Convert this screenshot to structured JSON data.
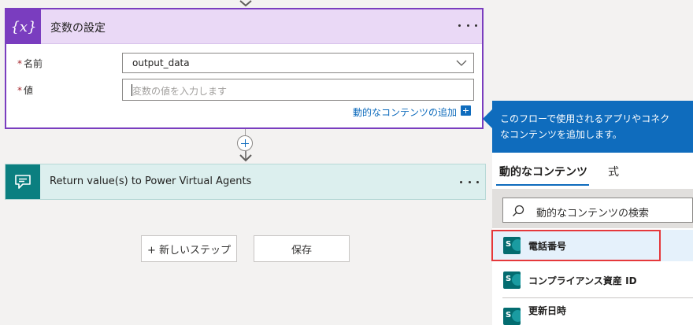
{
  "variable_card": {
    "title": "変数の設定",
    "icon": "variable-icon",
    "accent": "#7a3dbf",
    "name_label": "名前",
    "name_value": "output_data",
    "value_label": "値",
    "value_placeholder": "変数の値を入力します",
    "required_mark": "*",
    "dynamic_link": "動的なコンテンツの追加"
  },
  "return_card": {
    "title": "Return value(s) to Power Virtual Agents",
    "icon": "chat-icon",
    "accent": "#0b7f80"
  },
  "actions": {
    "new_step": "+ 新しいステップ",
    "save": "保存"
  },
  "panel": {
    "description_line1": "このフローで使用されるアプリやコネク",
    "description_line2": "なコンテンツを追加します。",
    "tabs": [
      "動的なコンテンツ",
      "式"
    ],
    "search_placeholder": "動的なコンテンツの検索",
    "items": [
      {
        "label": "電話番号",
        "icon": "sharepoint-icon",
        "highlighted": true
      },
      {
        "label": "コンプライアンス資産 ID",
        "icon": "sharepoint-icon"
      },
      {
        "label": "更新日時",
        "icon": "sharepoint-icon"
      }
    ]
  }
}
